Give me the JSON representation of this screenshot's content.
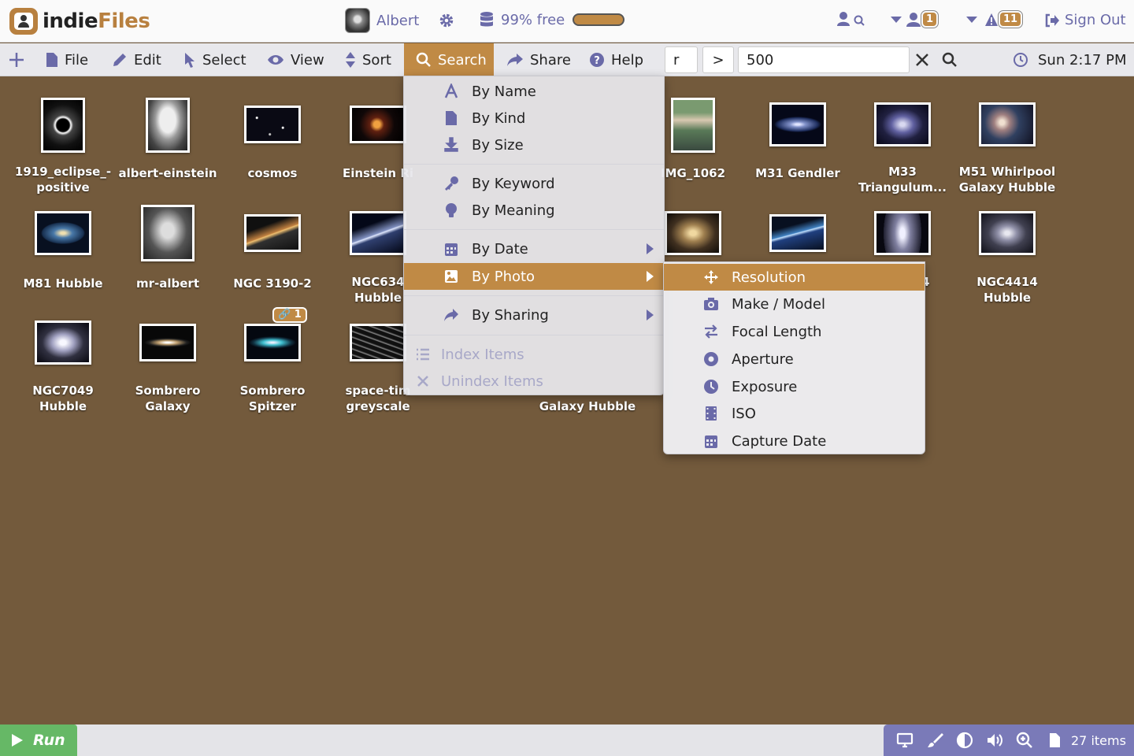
{
  "app": {
    "logo_part1": "indie",
    "logo_part2": "Files"
  },
  "header": {
    "user_name": "Albert",
    "disk_text": "99% free",
    "people_badge": "1",
    "alerts_badge": "11",
    "sign_out": "Sign Out"
  },
  "menubar": {
    "file": "File",
    "edit": "Edit",
    "select": "Select",
    "view": "View",
    "sort": "Sort",
    "search": "Search",
    "share": "Share",
    "help": "Help",
    "field_attr": "r",
    "field_op": ">",
    "field_value": "500",
    "clock": "Sun 2:17 PM"
  },
  "search_menu": {
    "by_name": "By Name",
    "by_kind": "By Kind",
    "by_size": "By Size",
    "by_keyword": "By Keyword",
    "by_meaning": "By Meaning",
    "by_date": "By Date",
    "by_photo": "By Photo",
    "by_sharing": "By Sharing",
    "index_items": "Index Items",
    "unindex_items": "Unindex Items"
  },
  "photo_menu": {
    "resolution": "Resolution",
    "make_model": "Make / Model",
    "focal_length": "Focal Length",
    "aperture": "Aperture",
    "exposure": "Exposure",
    "iso": "ISO",
    "capture_date": "Capture Date"
  },
  "files": [
    {
      "label": "1919_eclipse_-\npositive"
    },
    {
      "label": "albert-einstein"
    },
    {
      "label": "cosmos"
    },
    {
      "label": "Einstein Ri"
    },
    {
      "label": "IMG_1062"
    },
    {
      "label": "M31 Gendler"
    },
    {
      "label": "M33\nTriangulum..."
    },
    {
      "label": "M51 Whirlpool\nGalaxy Hubble"
    },
    {
      "label": "M81 Hubble"
    },
    {
      "label": "mr-albert"
    },
    {
      "label": "NGC 3190-2"
    },
    {
      "label": "NGC634\nHubble"
    },
    {
      "label": "4"
    },
    {
      "label": "NGC4414\nHubble"
    },
    {
      "label": "NGC7049\nHubble"
    },
    {
      "label": "Sombrero\nGalaxy"
    },
    {
      "label": "Sombrero\nSpitzer"
    },
    {
      "label": "space-tim\ngreyscale"
    },
    {
      "label": "Galaxy Hubble"
    }
  ],
  "link_badge_count": "1",
  "bottombar": {
    "run": "Run",
    "item_count": "27 items"
  }
}
